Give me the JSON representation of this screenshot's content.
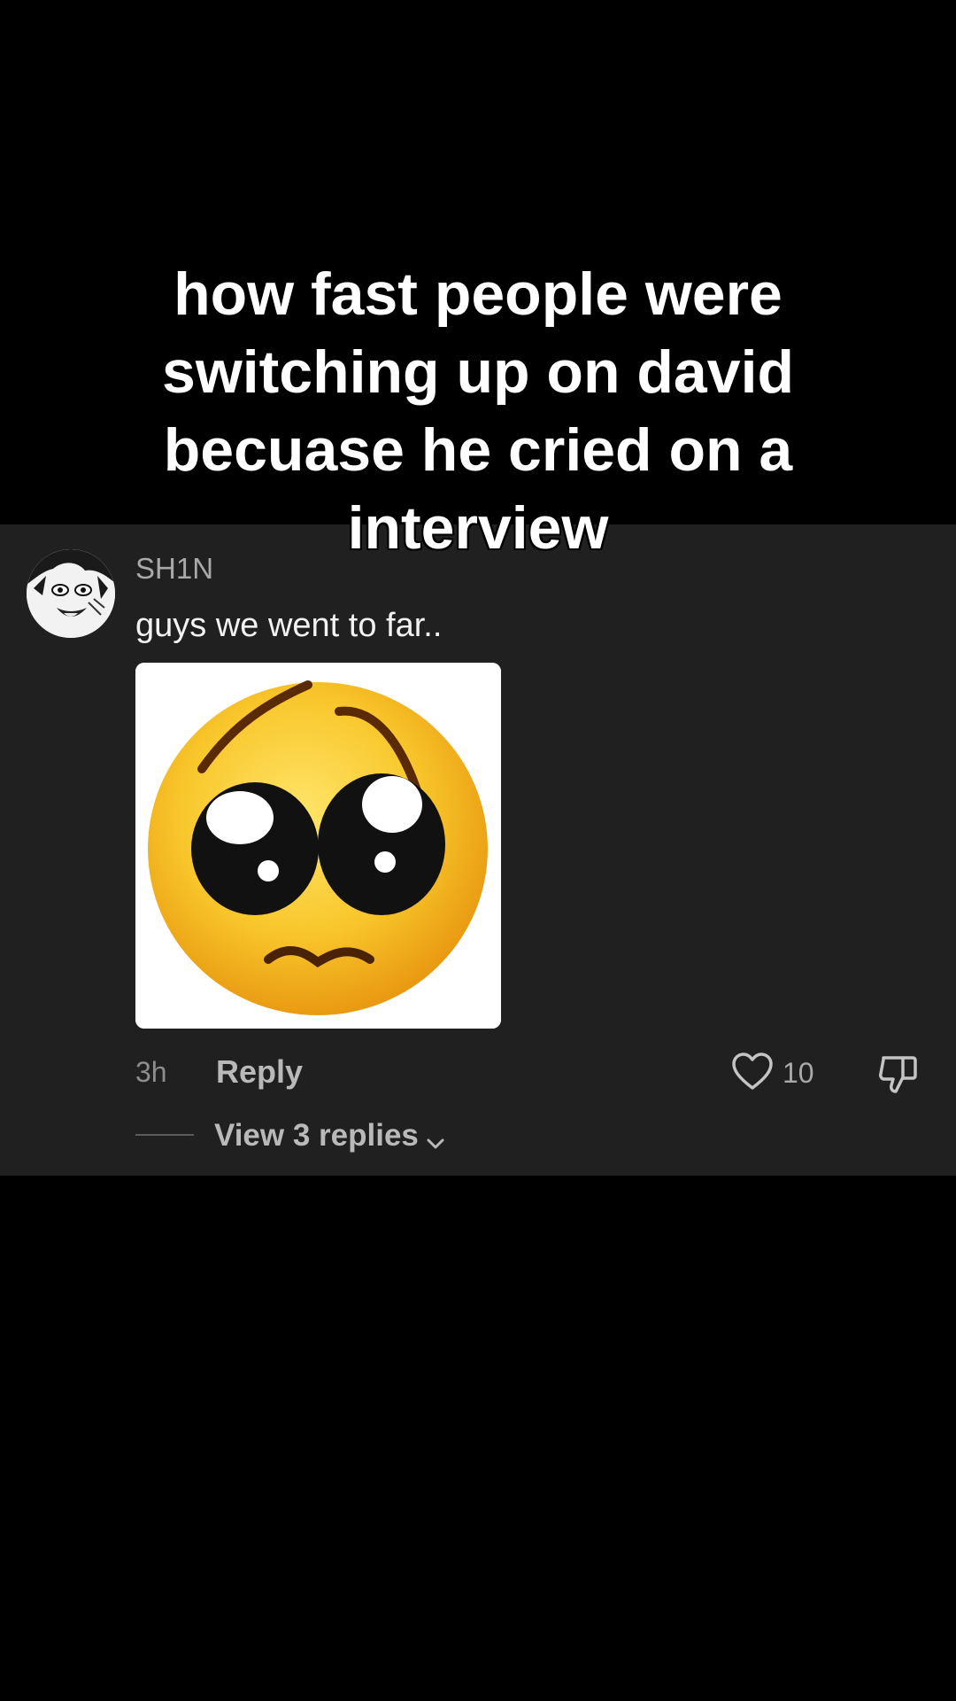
{
  "overlay": {
    "caption": "how fast people were switching up on david becuase he cried on a interview"
  },
  "comment": {
    "username": "SH1N",
    "text": "guys we went to far..",
    "timestamp": "3h",
    "reply_label": "Reply",
    "like_count": "10",
    "view_replies_label": "View 3 replies"
  },
  "icons": {
    "avatar": "avatar",
    "sticker": "crying-pleading-emoji-sticker",
    "like": "heart-icon",
    "dislike": "thumbs-down-icon",
    "chevron": "chevron-down-icon"
  },
  "colors": {
    "panel": "#202020",
    "background": "#000000",
    "emoji_yellow": "#f6c22a"
  }
}
